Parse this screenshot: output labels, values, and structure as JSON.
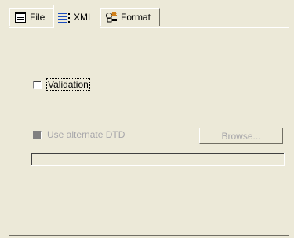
{
  "tabs": [
    {
      "label": "File",
      "icon": "file-properties-icon",
      "active": false
    },
    {
      "label": "XML",
      "icon": "xml-lines-icon",
      "active": true
    },
    {
      "label": "Format",
      "icon": "format-icon",
      "active": false
    }
  ],
  "xml_panel": {
    "validation": {
      "label": "Validation",
      "checked": false,
      "enabled": true
    },
    "alternate_dtd": {
      "label": "Use alternate DTD",
      "checked": false,
      "enabled": false
    },
    "browse_button": "Browse...",
    "dtd_path": ""
  },
  "colors": {
    "face": "#ece9d8",
    "disabled_text": "#a7a6aa",
    "xml_icon": "#1a4cc0",
    "format_icon_accent": "#d0801a"
  }
}
